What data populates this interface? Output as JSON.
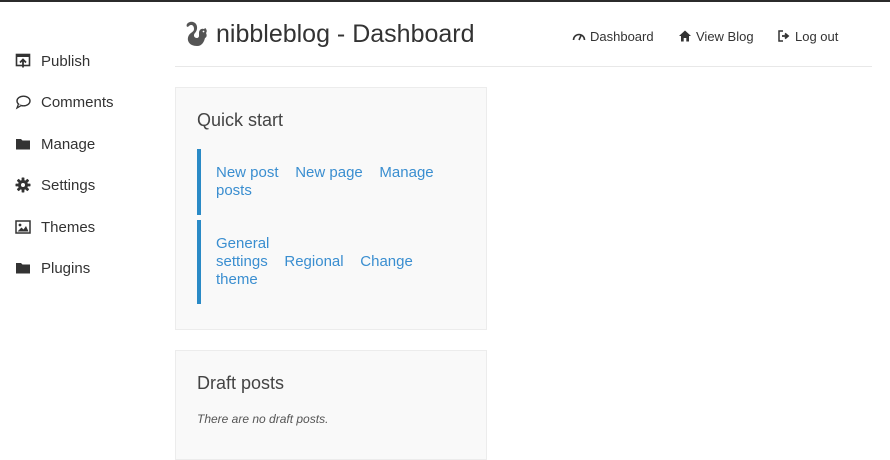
{
  "header": {
    "site_title": "nibbleblog - Dashboard",
    "nav": [
      {
        "label": "Dashboard",
        "icon": "speedometer-icon"
      },
      {
        "label": "View Blog",
        "icon": "home-icon"
      },
      {
        "label": "Log out",
        "icon": "logout-icon"
      }
    ]
  },
  "sidebar": {
    "items": [
      {
        "label": "Publish",
        "icon": "publish-icon"
      },
      {
        "label": "Comments",
        "icon": "comment-icon"
      },
      {
        "label": "Manage",
        "icon": "folder-icon"
      },
      {
        "label": "Settings",
        "icon": "gear-icon"
      },
      {
        "label": "Themes",
        "icon": "image-icon"
      },
      {
        "label": "Plugins",
        "icon": "folder-icon"
      }
    ]
  },
  "quick_start": {
    "title": "Quick start",
    "group1": {
      "new_post": "New post",
      "new_page": "New page",
      "manage_posts_1": "Manage",
      "manage_posts_2": "posts"
    },
    "group2": {
      "general_settings_1": "General",
      "general_settings_2": "settings",
      "regional": "Regional",
      "change_theme_1": "Change",
      "change_theme_2": "theme"
    }
  },
  "draft_posts": {
    "title": "Draft posts",
    "empty_message": "There are no draft posts."
  },
  "colors": {
    "accent": "#2a8ac6",
    "link": "#3a8ed0",
    "panel_bg": "#f9f9f9"
  }
}
